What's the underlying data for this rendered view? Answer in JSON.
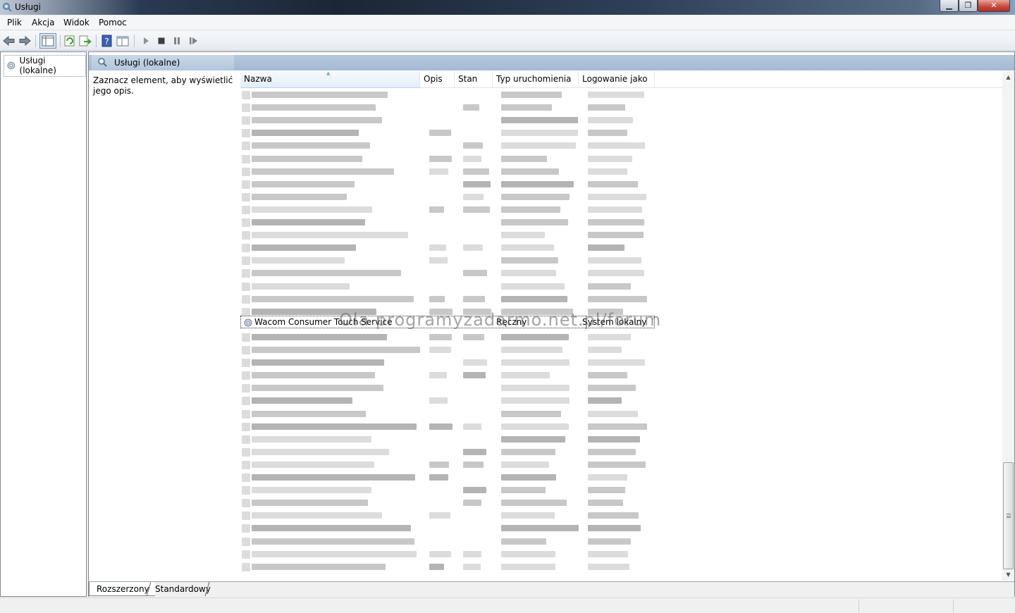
{
  "window": {
    "title": "Usługi"
  },
  "menu": [
    "Plik",
    "Akcja",
    "Widok",
    "Pomoc"
  ],
  "tree": {
    "root_label": "Usługi (lokalne)"
  },
  "pane_header": {
    "label": "Usługi (lokalne)"
  },
  "description_prompt": "Zaznacz element, aby wyświetlić jego opis.",
  "columns": {
    "name": "Nazwa",
    "description": "Opis",
    "status": "Stan",
    "startup_type": "Typ uruchomienia",
    "log_on_as": "Logowanie jako"
  },
  "selected_service": {
    "name": "Wacom Consumer Touch Service",
    "description": "",
    "status": "",
    "startup_type": "Ręczny",
    "log_on_as": "System lokalny"
  },
  "watermark": "Ola programyzadarmo.net.pl/forum",
  "tabs": [
    "Rozszerzony",
    "Standardowy"
  ],
  "toolbar_icons": [
    "back-icon",
    "forward-icon",
    "show-hide-console-tree-icon",
    "refresh-icon",
    "export-list-icon",
    "help-icon",
    "properties-icon",
    "start-service-icon",
    "stop-service-icon",
    "pause-service-icon",
    "restart-service-icon"
  ]
}
